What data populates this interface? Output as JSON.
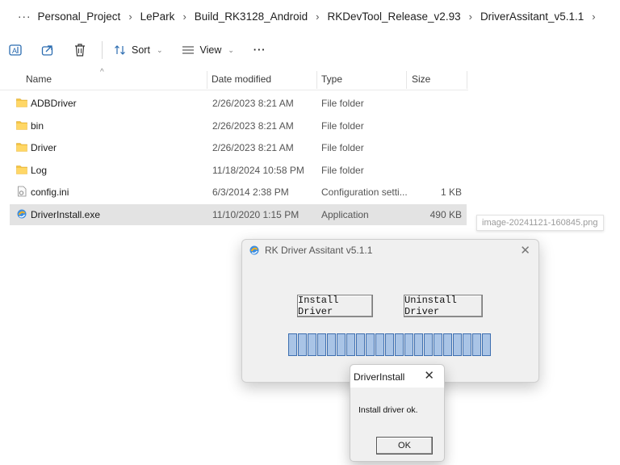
{
  "breadcrumb": {
    "more": "···",
    "items": [
      "Personal_Project",
      "LePark",
      "Build_RK3128_Android",
      "RKDevTool_Release_v2.93",
      "DriverAssitant_v5.1.1"
    ],
    "separator": "›"
  },
  "toolbar": {
    "sort_label": "Sort",
    "view_label": "View",
    "more_label": "···"
  },
  "columns": {
    "name": "Name",
    "date": "Date modified",
    "type": "Type",
    "size": "Size"
  },
  "files": [
    {
      "name": "ADBDriver",
      "date": "2/26/2023 8:21 AM",
      "type": "File folder",
      "size": "",
      "icon": "folder-icon"
    },
    {
      "name": "bin",
      "date": "2/26/2023 8:21 AM",
      "type": "File folder",
      "size": "",
      "icon": "folder-icon"
    },
    {
      "name": "Driver",
      "date": "2/26/2023 8:21 AM",
      "type": "File folder",
      "size": "",
      "icon": "folder-icon"
    },
    {
      "name": "Log",
      "date": "11/18/2024 10:58 PM",
      "type": "File folder",
      "size": "",
      "icon": "folder-icon"
    },
    {
      "name": "config.ini",
      "date": "6/3/2014 2:38 PM",
      "type": "Configuration setti...",
      "size": "1 KB",
      "icon": "ini-file-icon"
    },
    {
      "name": "DriverInstall.exe",
      "date": "11/10/2020 1:15 PM",
      "type": "Application",
      "size": "490 KB",
      "icon": "exe-file-icon"
    }
  ],
  "tooltip": "image-20241121-160845.png",
  "rk_dialog": {
    "title": "RK Driver Assitant v5.1.1",
    "install_label": "Install Driver",
    "uninstall_label": "Uninstall Driver",
    "progress_fraction": 1.0
  },
  "message_box": {
    "title": "DriverInstall",
    "message": "Install driver ok.",
    "ok_label": "OK"
  },
  "colors": {
    "folder": "#f5c542",
    "selection": "#e3e3e3",
    "progress_fill": "#a9c4e6",
    "progress_border": "#3e6fb0"
  }
}
